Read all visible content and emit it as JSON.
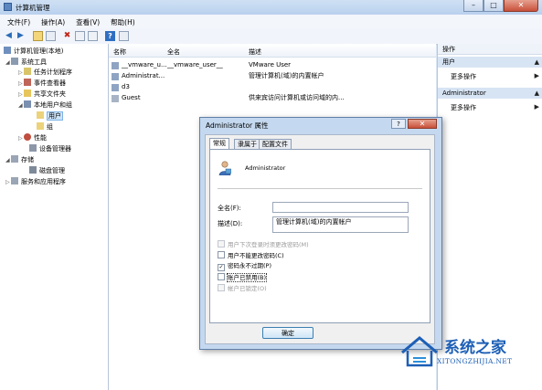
{
  "window": {
    "title": "计算机管理"
  },
  "menu": [
    "文件(F)",
    "操作(A)",
    "查看(V)",
    "帮助(H)"
  ],
  "tree": {
    "root": "计算机管理(本地)",
    "items": [
      {
        "label": "系统工具"
      },
      {
        "label": "任务计划程序"
      },
      {
        "label": "事件查看器"
      },
      {
        "label": "共享文件夹"
      },
      {
        "label": "本地用户和组"
      },
      {
        "label": "用户"
      },
      {
        "label": "组"
      },
      {
        "label": "性能"
      },
      {
        "label": "设备管理器"
      },
      {
        "label": "存储"
      },
      {
        "label": "磁盘管理"
      },
      {
        "label": "服务和应用程序"
      }
    ]
  },
  "list": {
    "headers": {
      "name": "名称",
      "fullname": "全名",
      "desc": "描述"
    },
    "rows": [
      {
        "name": "__vmware_u...",
        "fullname": "__vmware_user__",
        "desc": "VMware User"
      },
      {
        "name": "Administrat...",
        "fullname": "",
        "desc": "管理计算机(域)的内置帐户"
      },
      {
        "name": "d3",
        "fullname": "",
        "desc": ""
      },
      {
        "name": "Guest",
        "fullname": "",
        "desc": "供来宾访问计算机或访问域的内..."
      }
    ]
  },
  "actions": {
    "header": "操作",
    "group1": "用户",
    "more1": "更多操作",
    "group2": "Administrator",
    "more2": "更多操作"
  },
  "dialog": {
    "title": "Administrator 属性",
    "help": "?",
    "tabs": [
      "常规",
      "隶属于",
      "配置文件"
    ],
    "username": "Administrator",
    "fullname_label": "全名(F):",
    "fullname_value": "",
    "desc_label": "描述(D):",
    "desc_value": "管理计算机(域)的内置帐户",
    "checkboxes": [
      {
        "label": "用户下次登录时须更改密码(M)",
        "checked": false,
        "disabled": true
      },
      {
        "label": "用户不能更改密码(C)",
        "checked": false,
        "disabled": false
      },
      {
        "label": "密码永不过期(P)",
        "checked": true,
        "disabled": false
      },
      {
        "label": "账户已禁用(B)",
        "checked": false,
        "disabled": false
      },
      {
        "label": "帐户已锁定(O)",
        "checked": false,
        "disabled": true
      }
    ],
    "ok": "确定"
  },
  "watermark": {
    "title": "系统之家",
    "url": "XITONGZHIJIA.NET"
  },
  "colors": {
    "accent": "#1d5fb6",
    "selection": "#cde3f8",
    "panel": "#dbe6f4"
  }
}
